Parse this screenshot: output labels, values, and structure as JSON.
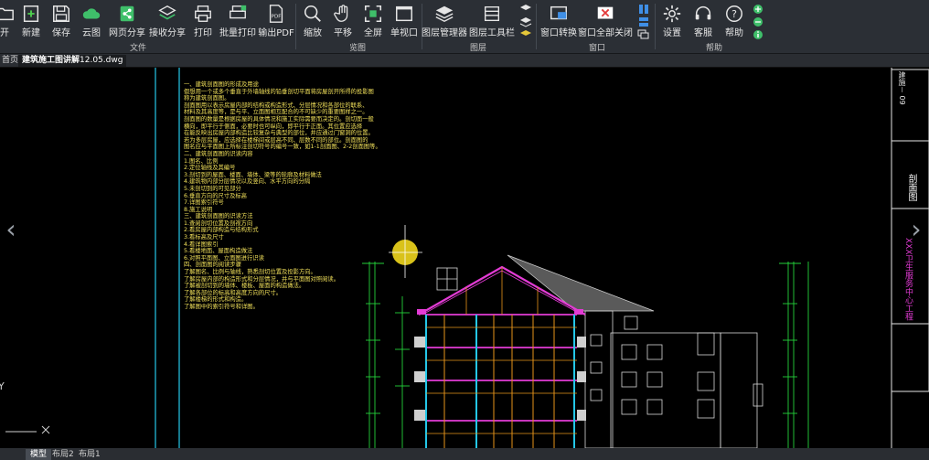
{
  "ribbon": {
    "file_group": {
      "label": "文件",
      "buttons": [
        {
          "label": "开",
          "icon": "open-folder-icon"
        },
        {
          "label": "新建",
          "icon": "new-file-icon"
        },
        {
          "label": "保存",
          "icon": "save-icon"
        },
        {
          "label": "云图",
          "icon": "cloud-icon"
        },
        {
          "label": "网页分享",
          "icon": "share-icon"
        },
        {
          "label": "接收分享",
          "icon": "receive-share-icon"
        },
        {
          "label": "打印",
          "icon": "print-icon"
        },
        {
          "label": "批量打印",
          "icon": "batch-print-icon"
        },
        {
          "label": "输出PDF",
          "icon": "pdf-icon"
        }
      ]
    },
    "view_group": {
      "label": "览图",
      "buttons": [
        {
          "label": "缩放",
          "icon": "zoom-icon"
        },
        {
          "label": "平移",
          "icon": "pan-hand-icon"
        },
        {
          "label": "全屏",
          "icon": "fullscreen-icon"
        },
        {
          "label": "单视口",
          "icon": "single-viewport-icon"
        }
      ]
    },
    "layer_group": {
      "label": "图层",
      "buttons": [
        {
          "label": "图层管理器",
          "icon": "layers-icon"
        },
        {
          "label": "图层工具栏",
          "icon": "layer-toolbar-icon"
        }
      ]
    },
    "window_group": {
      "label": "窗口",
      "buttons": [
        {
          "label": "窗口转换",
          "icon": "window-switch-icon"
        },
        {
          "label": "窗口全部关闭",
          "icon": "close-all-windows-icon"
        }
      ]
    },
    "help_group": {
      "label": "帮助",
      "buttons": [
        {
          "label": "设置",
          "icon": "settings-gear-icon"
        },
        {
          "label": "客服",
          "icon": "headset-icon"
        },
        {
          "label": "帮助",
          "icon": "help-icon"
        }
      ]
    }
  },
  "tabs": {
    "home": "首页",
    "active_file_bold": "建筑施工图讲解",
    "active_file_rest": "12.05.dwg"
  },
  "bottom_tabs": [
    "模型",
    "布局2",
    "布局1"
  ],
  "drawing": {
    "notes_text": "一、建筑剖面图的形成及用途\n假想用一个或多个垂直于外墙轴线的铅垂剖切平面将房屋剖开所得的投影图\n称为建筑剖面图。\n剖面图用以表示房屋内部的结构或构造形式、分层情况和各部位的联系、\n材料及其高度等，是与平、立面图相互配合的不可缺少的重要图样之一。\n剖面图的数量是根据房屋的具体情况和施工实际需要而决定的。剖切面一般\n横向，即平行于侧面，必要时也可纵向，即平行于正面。其位置应选择\n在能反映出房屋内部构造比较复杂与典型的部位，并应通过门窗洞的位置。\n若为多层房屋，应选择在楼梯间或层高不同、层数不同的部位。剖面图的\n图名应与平面图上所标注剖切符号的编号一致，如1-1剖面图、2-2剖面图等。\n二、建筑剖面图的识读内容\n1.图名、比例\n2.定位轴线及其编号\n3.剖切到的屋面、楼面、墙体、梁等的轮廓及材料做法\n4.建筑物内部分层情况以及竖向、水平方向的分隔\n5.未剖切到的可见部分\n6.垂直方向的尺寸及标高\n7.详图索引符号\n8.施工说明\n三、建筑剖面图的识读方法\n1.查阅剖切位置及剖视方向\n2.看房屋内部构造与结构形式\n3.看标高及尺寸\n4.看详图索引\n5.看楼地面、屋面构造做法\n6.对照平面图、立面图进行识读\n四、剖面图的阅读步骤\n了解图名、比例与轴线，熟悉剖切位置及投影方向。\n了解房屋内部的构造形式和分层情况，并与平面图对照阅读。\n了解被剖切到的墙体、楼板、屋面的构造做法。\n了解各部位的标高和高度方向的尺寸。\n了解楼梯的形式和构造。\n了解图中的索引符号和详图。",
    "titleblock_drawing_name": "剖面图",
    "titleblock_project": "XXX卫生服务中心工程",
    "titleblock_top_text": "建施－ 09",
    "left_axis_letter": "Y"
  },
  "colors": {
    "notes_text": "#f1e05a",
    "roof_magenta": "#e33bd5",
    "column_cyan": "#24c7e8",
    "dimension_green": "#24d13a",
    "title_text_magenta": "#e33bd5"
  }
}
